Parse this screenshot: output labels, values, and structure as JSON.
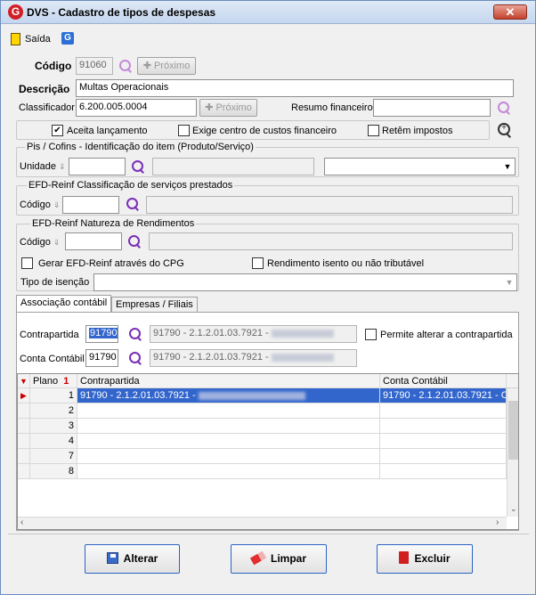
{
  "window": {
    "title": "DVS - Cadastro de tipos de despesas",
    "close_label": "✕",
    "logo_letter": "G"
  },
  "toolbar": {
    "exit_label": "Saída"
  },
  "form": {
    "codigo_label": "Código",
    "codigo_value": "91060",
    "proximo_label": "Próximo",
    "descricao_label": "Descrição",
    "descricao_value": "Multas Operacionais",
    "classificador_label": "Classificador",
    "classificador_value": "6.200.005.0004",
    "resumo_label": "Resumo financeiro",
    "resumo_value": "",
    "aceita_label": "Aceita lançamento",
    "aceita_checked": "✔",
    "exige_label": "Exige centro de custos financeiro",
    "retem_label": "Retêm impostos"
  },
  "pis": {
    "title": "Pis / Cofins - Identificação do item (Produto/Serviço)",
    "unidade_label": "Unidade"
  },
  "efd_class": {
    "title": "EFD-Reinf Classificação de serviços prestados",
    "codigo_label": "Código"
  },
  "efd_nat": {
    "title": "EFD-Reinf Natureza de Rendimentos",
    "codigo_label": "Código",
    "gerar_label": "Gerar EFD-Reinf através do CPG",
    "isento_label": "Rendimento isento ou não tributável",
    "tipo_label": "Tipo de isenção"
  },
  "tabs": [
    {
      "label": "Associação contábil"
    },
    {
      "label": "Empresas / Filiais"
    }
  ],
  "assoc": {
    "contrapartida_label": "Contrapartida",
    "contrapartida_value": "91790",
    "contrapartida_desc": "91790 - 2.1.2.01.03.7921 -",
    "permite_label": "Permite alterar a contrapartida",
    "conta_label": "Conta Contábil",
    "conta_value": "91790",
    "conta_desc": "91790 - 2.1.2.01.03.7921 -"
  },
  "grid": {
    "headers": {
      "plano": "Plano",
      "sort_mark": "1",
      "contrapartida": "Contrapartida",
      "conta": "Conta Contábil"
    },
    "rows": [
      {
        "num": "1",
        "contrapartida": "91790 - 2.1.2.01.03.7921 -",
        "conta": "91790 - 2.1.2.01.03.7921 - C"
      },
      {
        "num": "2",
        "contrapartida": "",
        "conta": ""
      },
      {
        "num": "3",
        "contrapartida": "",
        "conta": ""
      },
      {
        "num": "4",
        "contrapartida": "",
        "conta": ""
      },
      {
        "num": "7",
        "contrapartida": "",
        "conta": ""
      },
      {
        "num": "8",
        "contrapartida": "",
        "conta": ""
      }
    ]
  },
  "buttons": {
    "alterar": "Alterar",
    "limpar": "Limpar",
    "excluir": "Excluir"
  }
}
